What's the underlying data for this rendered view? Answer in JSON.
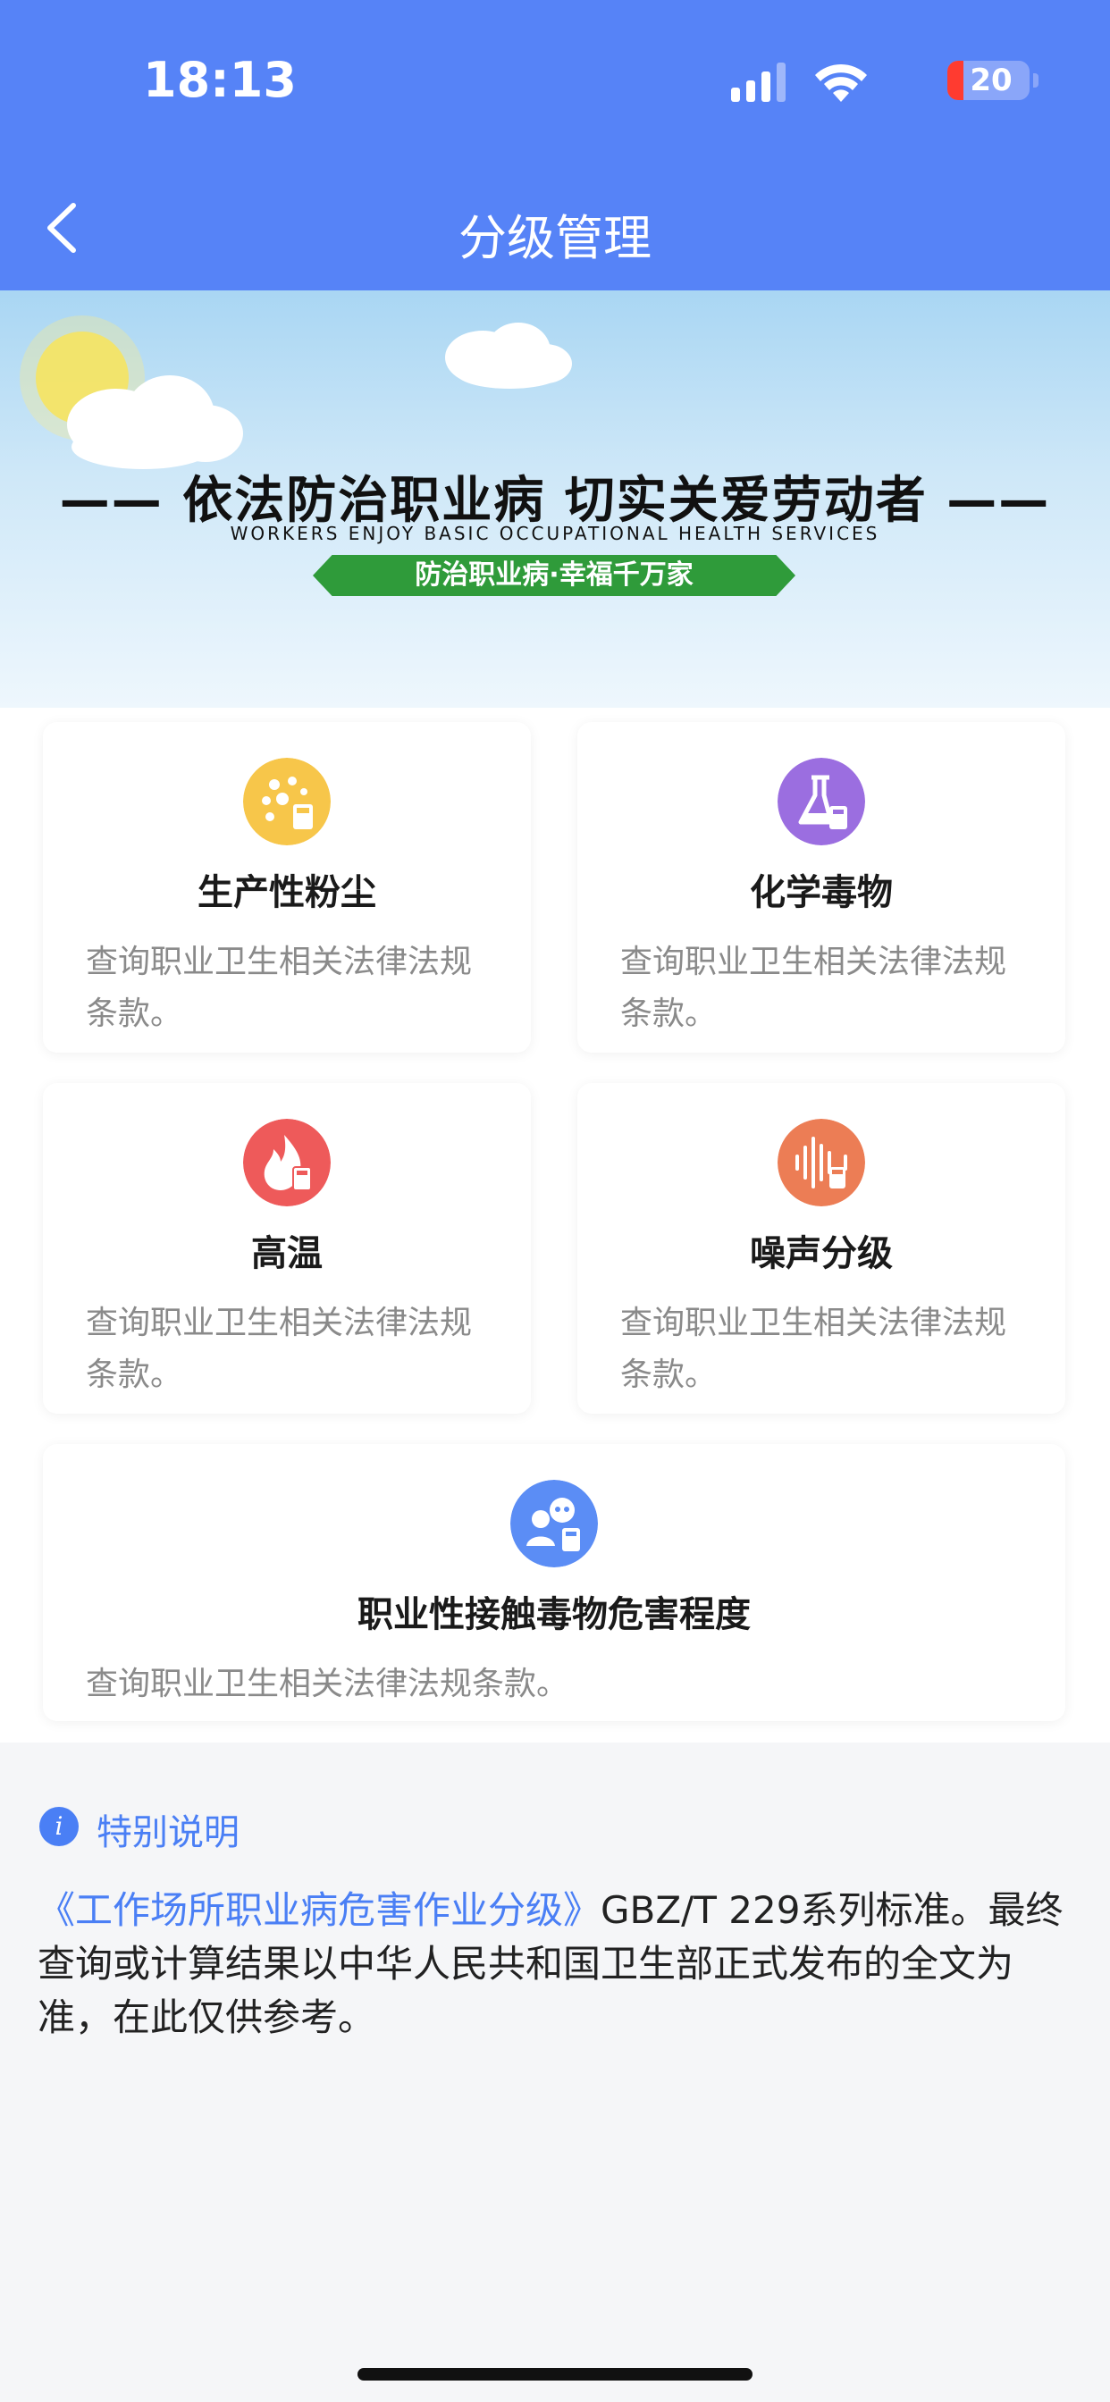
{
  "status_bar": {
    "time": "18:13",
    "battery": "20"
  },
  "nav": {
    "title": "分级管理",
    "back_icon": "chevron-left-icon"
  },
  "banner": {
    "title": "—— 依法防治职业病 切实关爱劳动者 ——",
    "subtitle": "WORKERS ENJOY BASIC OCCUPATIONAL HEALTH SERVICES",
    "slogan": "防治职业病·幸福千万家"
  },
  "cards": [
    {
      "title": "生产性粉尘",
      "desc": "查询职业卫生相关法律法规条款。",
      "icon": "dust-calculator-icon",
      "color": "#f7c64a"
    },
    {
      "title": "化学毒物",
      "desc": "查询职业卫生相关法律法规条款。",
      "icon": "flask-calculator-icon",
      "color": "#9b6ee0"
    },
    {
      "title": "高温",
      "desc": "查询职业卫生相关法律法规条款。",
      "icon": "flame-calculator-icon",
      "color": "#ee5a5a"
    },
    {
      "title": "噪声分级",
      "desc": "查询职业卫生相关法律法规条款。",
      "icon": "soundwave-calculator-icon",
      "color": "#ec7d55"
    },
    {
      "title": "职业性接触毒物危害程度",
      "desc": "查询职业卫生相关法律法规条款。",
      "icon": "skull-calculator-icon",
      "color": "#5b8df5"
    }
  ],
  "special": {
    "title": "特别说明",
    "link_text": "《工作场所职业病危害作业分级》",
    "text": "GBZ/T 229系列标准。最终查询或计算结果以中华人民共和国卫生部正式发布的全文为准，在此仅供参考。"
  },
  "colors": {
    "header": "#5683f7",
    "accent": "#4a7ff5"
  }
}
